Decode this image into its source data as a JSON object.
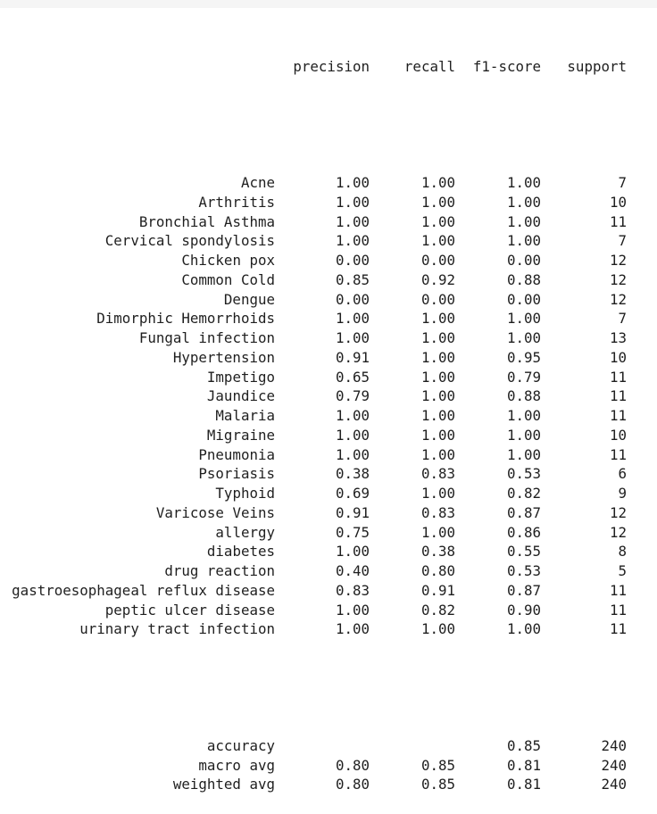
{
  "report": {
    "headers": {
      "precision": "precision",
      "recall": "recall",
      "f1": "f1-score",
      "support": "support"
    },
    "rows": [
      {
        "label": "Acne",
        "precision": "1.00",
        "recall": "1.00",
        "f1": "1.00",
        "support": "7"
      },
      {
        "label": "Arthritis",
        "precision": "1.00",
        "recall": "1.00",
        "f1": "1.00",
        "support": "10"
      },
      {
        "label": "Bronchial Asthma",
        "precision": "1.00",
        "recall": "1.00",
        "f1": "1.00",
        "support": "11"
      },
      {
        "label": "Cervical spondylosis",
        "precision": "1.00",
        "recall": "1.00",
        "f1": "1.00",
        "support": "7"
      },
      {
        "label": "Chicken pox",
        "precision": "0.00",
        "recall": "0.00",
        "f1": "0.00",
        "support": "12"
      },
      {
        "label": "Common Cold",
        "precision": "0.85",
        "recall": "0.92",
        "f1": "0.88",
        "support": "12"
      },
      {
        "label": "Dengue",
        "precision": "0.00",
        "recall": "0.00",
        "f1": "0.00",
        "support": "12"
      },
      {
        "label": "Dimorphic Hemorrhoids",
        "precision": "1.00",
        "recall": "1.00",
        "f1": "1.00",
        "support": "7"
      },
      {
        "label": "Fungal infection",
        "precision": "1.00",
        "recall": "1.00",
        "f1": "1.00",
        "support": "13"
      },
      {
        "label": "Hypertension",
        "precision": "0.91",
        "recall": "1.00",
        "f1": "0.95",
        "support": "10"
      },
      {
        "label": "Impetigo",
        "precision": "0.65",
        "recall": "1.00",
        "f1": "0.79",
        "support": "11"
      },
      {
        "label": "Jaundice",
        "precision": "0.79",
        "recall": "1.00",
        "f1": "0.88",
        "support": "11"
      },
      {
        "label": "Malaria",
        "precision": "1.00",
        "recall": "1.00",
        "f1": "1.00",
        "support": "11"
      },
      {
        "label": "Migraine",
        "precision": "1.00",
        "recall": "1.00",
        "f1": "1.00",
        "support": "10"
      },
      {
        "label": "Pneumonia",
        "precision": "1.00",
        "recall": "1.00",
        "f1": "1.00",
        "support": "11"
      },
      {
        "label": "Psoriasis",
        "precision": "0.38",
        "recall": "0.83",
        "f1": "0.53",
        "support": "6"
      },
      {
        "label": "Typhoid",
        "precision": "0.69",
        "recall": "1.00",
        "f1": "0.82",
        "support": "9"
      },
      {
        "label": "Varicose Veins",
        "precision": "0.91",
        "recall": "0.83",
        "f1": "0.87",
        "support": "12"
      },
      {
        "label": "allergy",
        "precision": "0.75",
        "recall": "1.00",
        "f1": "0.86",
        "support": "12"
      },
      {
        "label": "diabetes",
        "precision": "1.00",
        "recall": "0.38",
        "f1": "0.55",
        "support": "8"
      },
      {
        "label": "drug reaction",
        "precision": "0.40",
        "recall": "0.80",
        "f1": "0.53",
        "support": "5"
      },
      {
        "label": "gastroesophageal reflux disease",
        "precision": "0.83",
        "recall": "0.91",
        "f1": "0.87",
        "support": "11"
      },
      {
        "label": "peptic ulcer disease",
        "precision": "1.00",
        "recall": "0.82",
        "f1": "0.90",
        "support": "11"
      },
      {
        "label": "urinary tract infection",
        "precision": "1.00",
        "recall": "1.00",
        "f1": "1.00",
        "support": "11"
      }
    ],
    "summary": [
      {
        "label": "accuracy",
        "precision": "",
        "recall": "",
        "f1": "0.85",
        "support": "240"
      },
      {
        "label": "macro avg",
        "precision": "0.80",
        "recall": "0.85",
        "f1": "0.81",
        "support": "240"
      },
      {
        "label": "weighted avg",
        "precision": "0.80",
        "recall": "0.85",
        "f1": "0.81",
        "support": "240"
      }
    ]
  }
}
